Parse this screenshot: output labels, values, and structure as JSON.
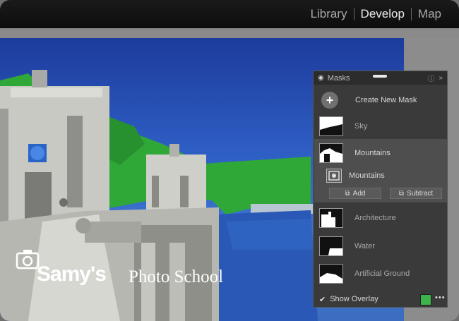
{
  "modules": {
    "library": "Library",
    "develop": "Develop",
    "map": "Map"
  },
  "panel": {
    "title": "Masks",
    "create_label": "Create New Mask",
    "create_icon": "plus-icon",
    "masks": [
      {
        "label": "Sky"
      },
      {
        "label": "Mountains"
      },
      {
        "label": "Architecture"
      },
      {
        "label": "Water"
      },
      {
        "label": "Artificial Ground"
      }
    ],
    "sub_component": "Mountains",
    "add_label": "Add",
    "subtract_label": "Subtract",
    "show_overlay_label": "Show Overlay",
    "show_overlay_checked": true,
    "overlay_color": "#3bb54a",
    "more_label": "•••"
  },
  "logo": {
    "text_big": "Samy's",
    "text_small": "Photo School"
  },
  "colors": {
    "overlay_green": "#3bb54a",
    "panel_bg": "#3a3a3a"
  }
}
